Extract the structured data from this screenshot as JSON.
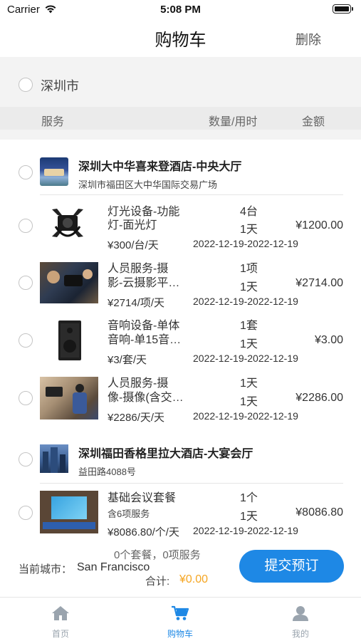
{
  "status": {
    "carrier": "Carrier",
    "time": "5:08 PM"
  },
  "nav": {
    "title": "购物车",
    "delete_label": "删除"
  },
  "city": {
    "name": "深圳市"
  },
  "columns": {
    "service": "服务",
    "qty_time": "数量/用时",
    "amount": "金额"
  },
  "venues": [
    {
      "name": "深圳大中华喜来登酒店-中央大厅",
      "address": "深圳市福田区大中华国际交易广场",
      "items": [
        {
          "title_line1": "灯光设备-功能",
          "title_line2": "灯-面光灯",
          "qty": "4台",
          "days": "1天",
          "amount": "¥1200.00",
          "unit_price": "¥300/台/天",
          "dates": "2022-12-19-2022-12-19"
        },
        {
          "title_line1": "人员服务-摄",
          "title_line2": "影-云摄影平…",
          "qty": "1项",
          "days": "1天",
          "amount": "¥2714.00",
          "unit_price": "¥2714/项/天",
          "dates": "2022-12-19-2022-12-19"
        },
        {
          "title_line1": "音响设备-单体",
          "title_line2": "音响-单15音…",
          "qty": "1套",
          "days": "1天",
          "amount": "¥3.00",
          "unit_price": "¥3/套/天",
          "dates": "2022-12-19-2022-12-19"
        },
        {
          "title_line1": "人员服务-摄",
          "title_line2": "像-摄像(含交…",
          "qty": "1天",
          "days": "1天",
          "amount": "¥2286.00",
          "unit_price": "¥2286/天/天",
          "dates": "2022-12-19-2022-12-19"
        }
      ]
    },
    {
      "name": "深圳福田香格里拉大酒店-大宴会厅",
      "address": "益田路4088号",
      "items": [
        {
          "title_line1": "基础会议套餐",
          "title_line2": "含6项服务",
          "qty": "1个",
          "days": "1天",
          "amount": "¥8086.80",
          "unit_price": "¥8086.80/个/天",
          "dates": "2022-12-19-2022-12-19"
        }
      ]
    }
  ],
  "summary": {
    "counts": "0个套餐，0项服务",
    "current_city_label": "当前城市：",
    "current_city": "San Francisco",
    "total_label": "合计:",
    "total": "¥0.00",
    "submit_label": "提交预订"
  },
  "tabs": [
    {
      "label": "首页",
      "icon": "home-icon",
      "active": false
    },
    {
      "label": "购物车",
      "icon": "cart-icon",
      "active": true
    },
    {
      "label": "我的",
      "icon": "profile-icon",
      "active": false
    }
  ],
  "colors": {
    "accent": "#1e88e5",
    "price": "#f5a623",
    "inactive_tab": "#9aa4ae"
  }
}
